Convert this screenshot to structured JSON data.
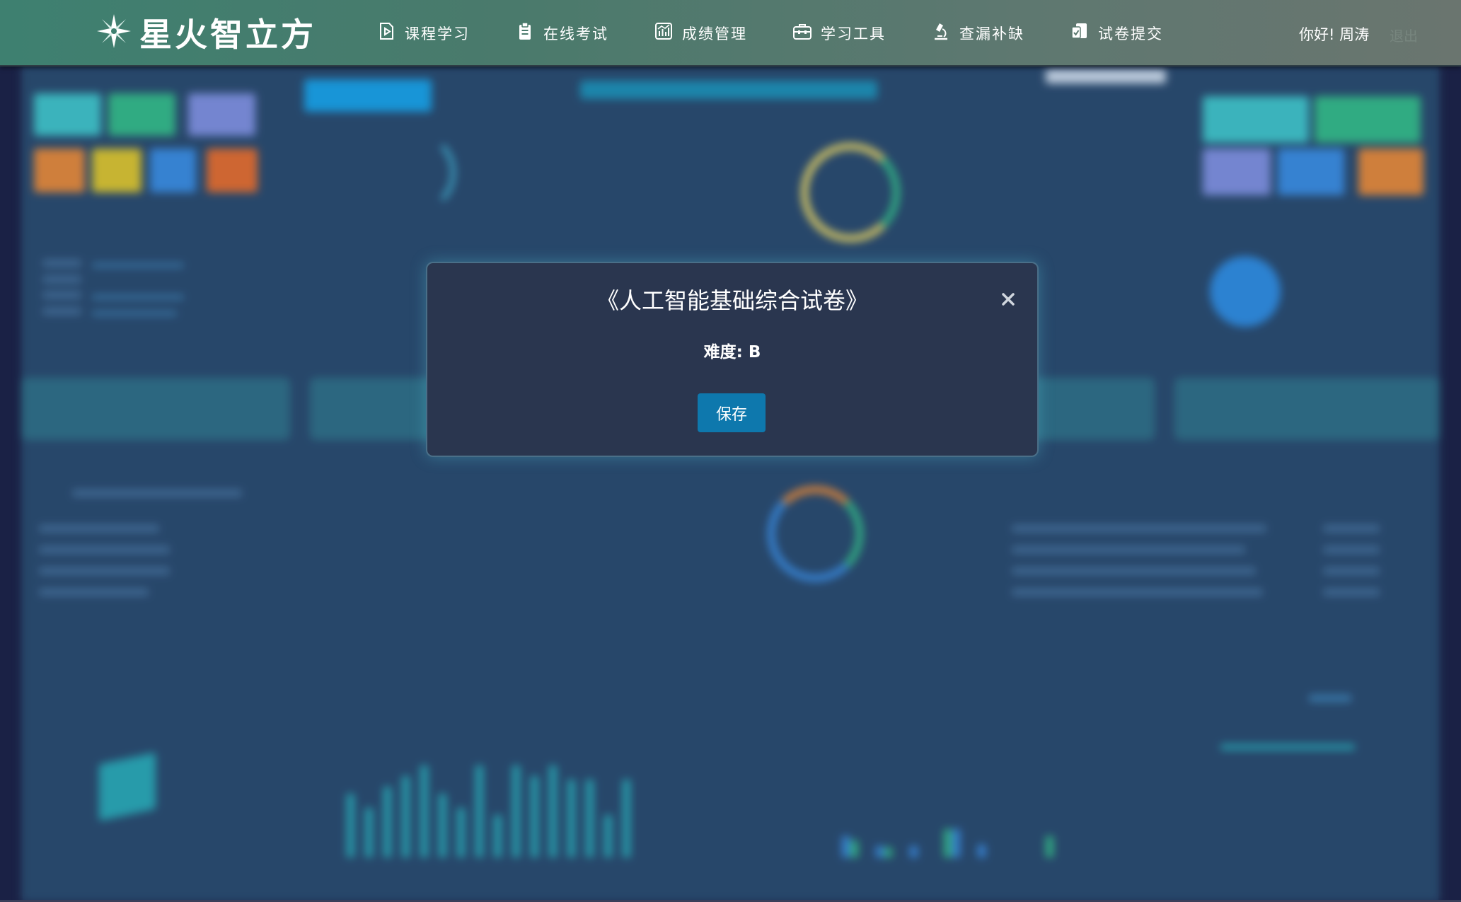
{
  "brand": {
    "name": "星火智立方"
  },
  "nav": {
    "items": [
      {
        "label": "课程学习",
        "icon": "play-doc-icon"
      },
      {
        "label": "在线考试",
        "icon": "clipboard-icon"
      },
      {
        "label": "成绩管理",
        "icon": "chart-icon"
      },
      {
        "label": "学习工具",
        "icon": "toolbox-icon"
      },
      {
        "label": "查漏补缺",
        "icon": "microscope-icon"
      },
      {
        "label": "试卷提交",
        "icon": "submit-doc-icon"
      }
    ]
  },
  "user": {
    "greeting": "你好! 周涛",
    "logout_label": "退出"
  },
  "modal": {
    "title": "《人工智能基础综合试卷》",
    "difficulty": "难度: B",
    "save_label": "保存",
    "close_icon": "close-icon"
  },
  "colors": {
    "accent": "#0e78ad",
    "topbar_start": "#3e8070",
    "modal_bg": "#2a364f",
    "background": "#2a4b70"
  }
}
